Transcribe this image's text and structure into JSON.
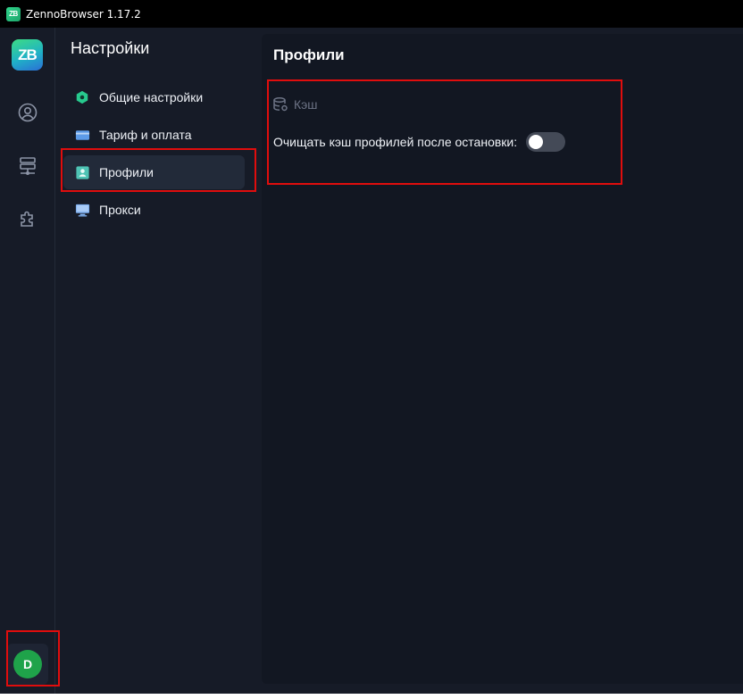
{
  "window": {
    "title": "ZennoBrowser 1.17.2",
    "logo_text": "ZB"
  },
  "rail": {
    "logo_text": "ZB",
    "items": [
      {
        "icon": "user-circle-icon"
      },
      {
        "icon": "network-icon"
      },
      {
        "icon": "puzzle-icon"
      }
    ],
    "avatar_letter": "D",
    "avatar_color": "#1fa34a"
  },
  "nav": {
    "title": "Настройки",
    "items": [
      {
        "label": "Общие настройки",
        "icon": "hexagon-icon"
      },
      {
        "label": "Тариф и оплата",
        "icon": "credit-card-icon"
      },
      {
        "label": "Профили",
        "icon": "profile-card-icon",
        "active": true
      },
      {
        "label": "Прокси",
        "icon": "monitor-icon"
      }
    ]
  },
  "main": {
    "title": "Профили",
    "section": {
      "title": "Кэш",
      "icon": "database-icon"
    },
    "setting": {
      "label": "Очищать кэш профилей после остановки:",
      "toggle_on": false
    }
  },
  "colors": {
    "accent_green": "#3ddc84",
    "highlight_red": "#e00d0d",
    "background": "#161b27"
  }
}
